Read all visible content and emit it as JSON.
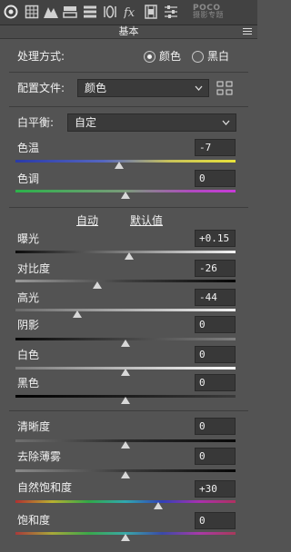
{
  "toolbar": {
    "icons": [
      "aperture-icon",
      "grid-icon",
      "mountain-icon",
      "split-icon",
      "panels-icon",
      "lens-icon",
      "fx-icon",
      "film-icon",
      "sliders-icon"
    ],
    "watermark_line1": "POCO",
    "watermark_line2": "摄影专题"
  },
  "panel": {
    "title": "基本",
    "menu_icon": "panel-menu-icon"
  },
  "treatment": {
    "label": "处理方式:",
    "option_color": "颜色",
    "option_bw": "黑白",
    "selected": "颜色"
  },
  "profile": {
    "label": "配置文件:",
    "value": "颜色"
  },
  "white_balance": {
    "label": "白平衡:",
    "value": "自定"
  },
  "sliders_wb": [
    {
      "label": "色温",
      "value": "-7",
      "level": 0.47
    },
    {
      "label": "色调",
      "value": "0",
      "level": 0.5
    }
  ],
  "tone_links": {
    "auto": "自动",
    "default": "默认值"
  },
  "sliders_tone": [
    {
      "label": "曝光",
      "value": "+0.15",
      "level": 0.515
    },
    {
      "label": "对比度",
      "value": "-26",
      "level": 0.37
    },
    {
      "label": "高光",
      "value": "-44",
      "level": 0.28
    },
    {
      "label": "阴影",
      "value": "0",
      "level": 0.5
    },
    {
      "label": "白色",
      "value": "0",
      "level": 0.5
    },
    {
      "label": "黑色",
      "value": "0",
      "level": 0.5
    }
  ],
  "sliders_presence": [
    {
      "label": "清晰度",
      "value": "0",
      "level": 0.5
    },
    {
      "label": "去除薄雾",
      "value": "0",
      "level": 0.5
    },
    {
      "label": "自然饱和度",
      "value": "+30",
      "level": 0.65
    },
    {
      "label": "饱和度",
      "value": "0",
      "level": 0.5
    }
  ],
  "colors": {
    "background": "#535353",
    "toolbar": "#424242",
    "field": "#383838"
  }
}
